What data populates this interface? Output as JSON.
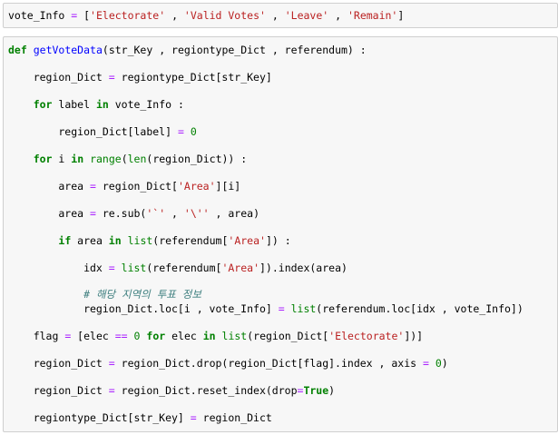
{
  "cells": [
    {
      "lines": [
        [
          [
            "tx",
            "vote_Info "
          ],
          [
            "op",
            "="
          ],
          [
            "tx",
            " ["
          ],
          [
            "st",
            "'Electorate'"
          ],
          [
            "tx",
            " , "
          ],
          [
            "st",
            "'Valid Votes'"
          ],
          [
            "tx",
            " , "
          ],
          [
            "st",
            "'Leave'"
          ],
          [
            "tx",
            " , "
          ],
          [
            "st",
            "'Remain'"
          ],
          [
            "tx",
            "]"
          ]
        ]
      ]
    },
    {
      "lines": [
        [
          [
            "kw",
            "def"
          ],
          [
            "tx",
            " "
          ],
          [
            "fn",
            "getVoteData"
          ],
          [
            "tx",
            "(str_Key , regiontype_Dict , referendum) :"
          ]
        ],
        [
          [
            "tx",
            "    region_Dict "
          ],
          [
            "op",
            "="
          ],
          [
            "tx",
            " regiontype_Dict[str_Key]"
          ]
        ],
        [
          [
            "tx",
            "    "
          ],
          [
            "kw",
            "for"
          ],
          [
            "tx",
            " label "
          ],
          [
            "kw",
            "in"
          ],
          [
            "tx",
            " vote_Info :"
          ]
        ],
        [
          [
            "tx",
            "        region_Dict[label] "
          ],
          [
            "op",
            "="
          ],
          [
            "tx",
            " "
          ],
          [
            "nm",
            "0"
          ]
        ],
        [
          [
            "tx",
            "    "
          ],
          [
            "kw",
            "for"
          ],
          [
            "tx",
            " i "
          ],
          [
            "kw",
            "in"
          ],
          [
            "tx",
            " "
          ],
          [
            "bi",
            "range"
          ],
          [
            "tx",
            "("
          ],
          [
            "bi",
            "len"
          ],
          [
            "tx",
            "(region_Dict)) :"
          ]
        ],
        [
          [
            "tx",
            "        area "
          ],
          [
            "op",
            "="
          ],
          [
            "tx",
            " region_Dict["
          ],
          [
            "st",
            "'Area'"
          ],
          [
            "tx",
            "][i]"
          ]
        ],
        [
          [
            "tx",
            "        area "
          ],
          [
            "op",
            "="
          ],
          [
            "tx",
            " re.sub("
          ],
          [
            "st",
            "'`'"
          ],
          [
            "tx",
            " , "
          ],
          [
            "st",
            "'\\''"
          ],
          [
            "tx",
            " , area)"
          ]
        ],
        [
          [
            "tx",
            "        "
          ],
          [
            "kw",
            "if"
          ],
          [
            "tx",
            " area "
          ],
          [
            "kw",
            "in"
          ],
          [
            "tx",
            " "
          ],
          [
            "bi",
            "list"
          ],
          [
            "tx",
            "(referendum["
          ],
          [
            "st",
            "'Area'"
          ],
          [
            "tx",
            "]) :"
          ]
        ],
        [
          [
            "tx",
            "            idx "
          ],
          [
            "op",
            "="
          ],
          [
            "tx",
            " "
          ],
          [
            "bi",
            "list"
          ],
          [
            "tx",
            "(referendum["
          ],
          [
            "st",
            "'Area'"
          ],
          [
            "tx",
            "]).index(area)"
          ]
        ],
        [
          [
            "tx",
            "            "
          ],
          [
            "cm",
            "# 해당 지역의 투표 정보"
          ]
        ],
        [
          [
            "tx",
            "            region_Dict.loc[i , vote_Info] "
          ],
          [
            "op",
            "="
          ],
          [
            "tx",
            " "
          ],
          [
            "bi",
            "list"
          ],
          [
            "tx",
            "(referendum.loc[idx , vote_Info])"
          ]
        ],
        [
          [
            "tx",
            "    flag "
          ],
          [
            "op",
            "="
          ],
          [
            "tx",
            " [elec "
          ],
          [
            "op",
            "=="
          ],
          [
            "tx",
            " "
          ],
          [
            "nm",
            "0"
          ],
          [
            "tx",
            " "
          ],
          [
            "kw",
            "for"
          ],
          [
            "tx",
            " elec "
          ],
          [
            "kw",
            "in"
          ],
          [
            "tx",
            " "
          ],
          [
            "bi",
            "list"
          ],
          [
            "tx",
            "(region_Dict["
          ],
          [
            "st",
            "'Electorate'"
          ],
          [
            "tx",
            "])]"
          ]
        ],
        [
          [
            "tx",
            "    region_Dict "
          ],
          [
            "op",
            "="
          ],
          [
            "tx",
            " region_Dict.drop(region_Dict[flag].index , axis "
          ],
          [
            "op",
            "="
          ],
          [
            "tx",
            " "
          ],
          [
            "nm",
            "0"
          ],
          [
            "tx",
            ")"
          ]
        ],
        [
          [
            "tx",
            "    region_Dict "
          ],
          [
            "op",
            "="
          ],
          [
            "tx",
            " region_Dict.reset_index(drop"
          ],
          [
            "op",
            "="
          ],
          [
            "kw",
            "True"
          ],
          [
            "tx",
            ")"
          ]
        ],
        [
          [
            "tx",
            "    regiontype_Dict[str_Key] "
          ],
          [
            "op",
            "="
          ],
          [
            "tx",
            " region_Dict"
          ]
        ]
      ]
    }
  ]
}
